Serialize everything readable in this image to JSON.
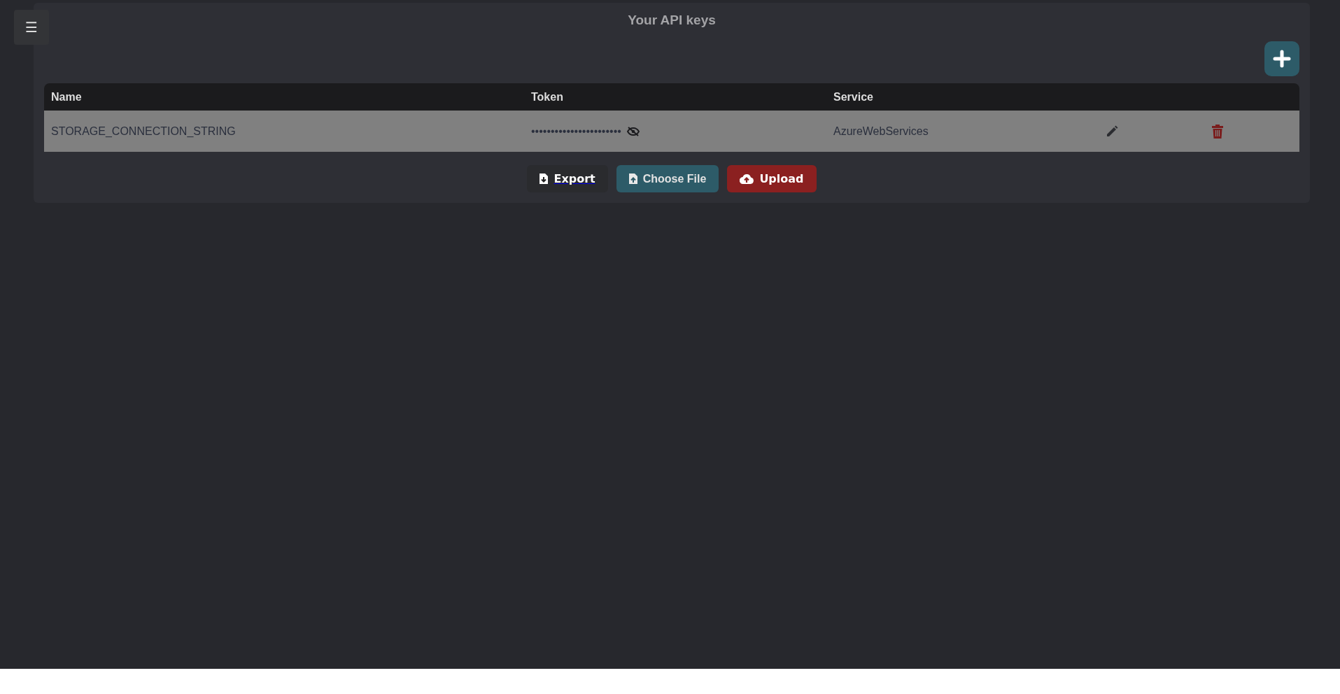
{
  "menu_button": {
    "label": "☰"
  },
  "panel": {
    "title": "Your API keys"
  },
  "table": {
    "columns": [
      "Name",
      "Token",
      "Service"
    ],
    "rows": [
      {
        "name": "STORAGE_CONNECTION_STRING",
        "token": "•••••••••••••••••••••••",
        "token_visible": false,
        "service": "AzureWebServices"
      }
    ]
  },
  "buttons": [
    {
      "kind": "export",
      "label": "Export"
    },
    {
      "kind": "choose",
      "label": "Choose File"
    },
    {
      "kind": "upload",
      "label": "Upload"
    }
  ]
}
